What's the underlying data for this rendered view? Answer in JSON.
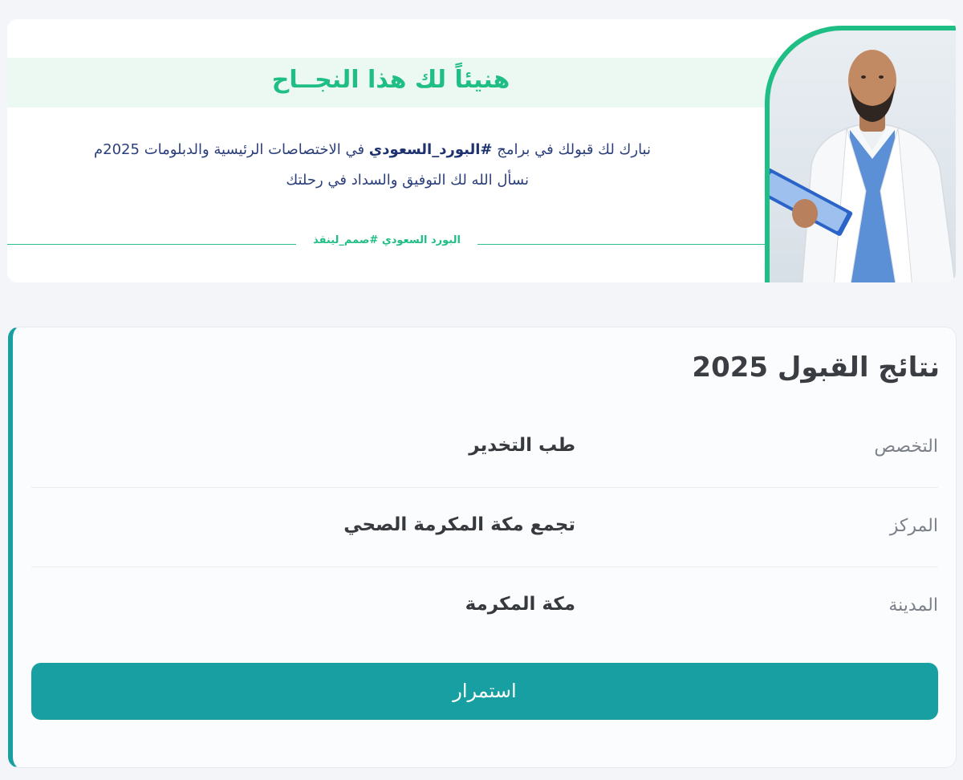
{
  "banner": {
    "title": "هنيئاً لك هذا النجــاح",
    "line1_prefix": "نبارك لك قبولك في برامج",
    "line1_bold": "#البورد_السعودي",
    "line1_suffix": "في الاختصاصات الرئيسية والدبلومات 2025م",
    "line2": "نسأل الله لك التوفيق والسداد في رحلتك",
    "tag": "البورد السعودي #صمم_لينقذ"
  },
  "card": {
    "title": "نتائج القبول 2025",
    "rows": [
      {
        "label": "التخصص",
        "value": "طب التخدير"
      },
      {
        "label": "المركز",
        "value": "تجمع مكة المكرمة الصحي"
      },
      {
        "label": "المدينة",
        "value": "مكة المكرمة"
      }
    ],
    "continue_label": "استمرار"
  },
  "colors": {
    "brand_green": "#1fbe84",
    "brand_teal": "#179fa2",
    "text_navy": "#2b3f7a"
  }
}
